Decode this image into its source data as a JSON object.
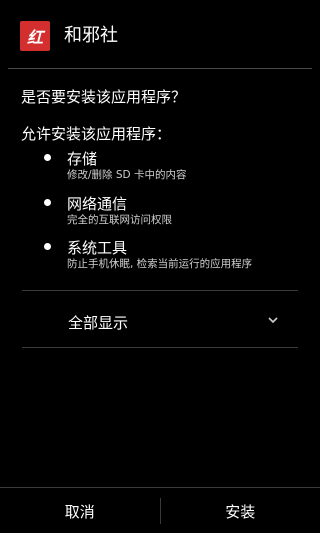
{
  "header": {
    "icon": "app-logo-icon",
    "icon_text": "红",
    "title": "和邪社"
  },
  "prompt": {
    "question": "是否要安装该应用程序？",
    "allow_label": "允许安装该应用程序："
  },
  "permissions": [
    {
      "title": "存储",
      "description": "修改/删除 SD 卡中的内容"
    },
    {
      "title": "网络通信",
      "description": "完全的互联网访问权限"
    },
    {
      "title": "系统工具",
      "description": "防止手机休眠, 检索当前运行的应用程序"
    }
  ],
  "show_all": {
    "label": "全部显示",
    "icon": "chevron-down-icon"
  },
  "buttons": {
    "cancel": "取消",
    "install": "安装"
  },
  "colors": {
    "background": "#000000",
    "icon_red": "#d32f2f",
    "divider": "#3a3a3a"
  }
}
